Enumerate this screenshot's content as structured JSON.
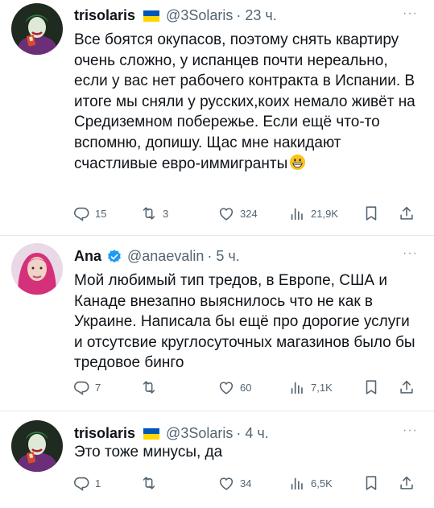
{
  "colors": {
    "text": "#0f1419",
    "secondary": "#536471",
    "verified": "#1d9bf0"
  },
  "tweets": [
    {
      "author": "trisolaris",
      "flag": "ukraine-flag",
      "handle": "@3Solaris",
      "time": "· 23 ч.",
      "text": "Все боятся окупасов, поэтому снять квартиру очень сложно, у испанцев почти нереально, если у вас нет рабочего контракта в Испании. В итоге мы сняли у русских,коих немало живёт на Средиземном побережье. Если ещё что-то вспомню, допишу. Щас мне накидают счастливые евро-иммигранты",
      "emoji": "grinning-face-emoji",
      "replies": "15",
      "reposts": "3",
      "likes": "324",
      "views": "21,9K"
    },
    {
      "author": "Ana",
      "verified": "verified-badge",
      "handle": "@anaevalin",
      "time": "· 5 ч.",
      "text": "Мой любимый тип тредов, в Европе, США и Канаде внезапно выяснилось что не как в Украине. Написала бы ещё про дорогие услуги и отсутсвие круглосуточных магазинов было бы тредовое бинго",
      "replies": "7",
      "reposts": "",
      "likes": "60",
      "views": "7,1K"
    },
    {
      "author": "trisolaris",
      "flag": "ukraine-flag",
      "handle": "@3Solaris",
      "time": "· 4 ч.",
      "text": "Это тоже минусы, да",
      "replies": "1",
      "reposts": "",
      "likes": "34",
      "views": "6,5K"
    }
  ],
  "more_label": "···"
}
